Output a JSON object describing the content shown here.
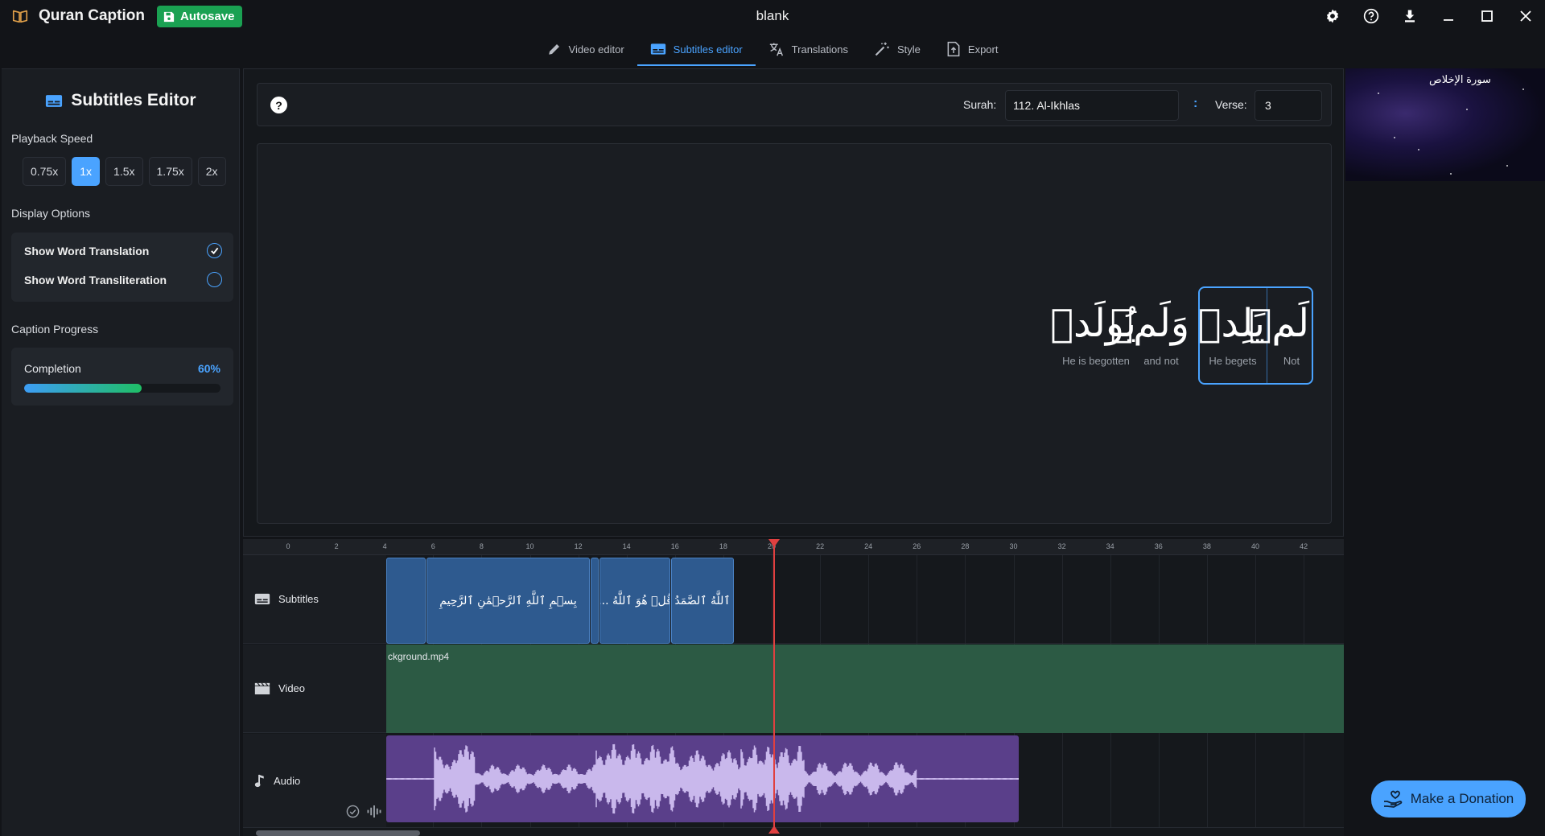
{
  "app": {
    "title": "Quran Caption",
    "autosave_label": "Autosave",
    "project_name": "blank"
  },
  "tabs": [
    {
      "label": "Video editor",
      "icon": "pencil-icon"
    },
    {
      "label": "Subtitles editor",
      "icon": "subtitles-icon"
    },
    {
      "label": "Translations",
      "icon": "translate-icon"
    },
    {
      "label": "Style",
      "icon": "magic-wand-icon"
    },
    {
      "label": "Export",
      "icon": "export-icon"
    }
  ],
  "sidebar": {
    "title": "Subtitles Editor",
    "playback_speed_label": "Playback Speed",
    "speeds": [
      "0.75x",
      "1x",
      "1.5x",
      "1.75x",
      "2x"
    ],
    "active_speed": "1x",
    "display_options_label": "Display Options",
    "show_word_translation_label": "Show Word Translation",
    "show_word_transliteration_label": "Show Word Transliteration",
    "show_word_translation": true,
    "show_word_transliteration": false,
    "caption_progress_label": "Caption Progress",
    "completion_label": "Completion",
    "completion_text": "60%",
    "completion_value": 0.6
  },
  "editor": {
    "surah_label": "Surah:",
    "surah_value": "112. Al-Ikhlas",
    "colon": ":",
    "verse_label": "Verse:",
    "verse_value": "3",
    "words": [
      {
        "arabic": "لَمۡ",
        "translation": "Not"
      },
      {
        "arabic": "يَلِدۡ",
        "translation": "He begets"
      },
      {
        "arabic": "وَلَمۡ",
        "translation": "and not"
      },
      {
        "arabic": "يُولَدۡ",
        "translation": "He is begotten"
      }
    ]
  },
  "preview": {
    "caption": "سورة الإخلاص"
  },
  "timeline": {
    "ticks": [
      "0",
      "2",
      "4",
      "6",
      "8",
      "10",
      "12",
      "14",
      "16",
      "18",
      "20",
      "22",
      "24",
      "26",
      "28",
      "30",
      "32",
      "34",
      "36",
      "38",
      "40",
      "42"
    ],
    "tracks": {
      "subtitles": "Subtitles",
      "video": "Video",
      "audio": "Audio"
    },
    "subtitle_blocks": [
      {
        "text": ""
      },
      {
        "text": "بِسۡمِ ٱللَّهِ ٱلرَّحۡمَٰنِ ٱلرَّحِيمِ"
      },
      {
        "text": ""
      },
      {
        "text": "قُلۡ هُوَ ٱللَّهُ ..."
      },
      {
        "text": "ٱللَّهُ ٱلصَّمَدُ"
      }
    ],
    "video_file": "ckground.mp4"
  },
  "donate_label": "Make a Donation",
  "colors": {
    "accent": "#4aa3ff",
    "autosave": "#1aa152",
    "video_track": "#2c5a44",
    "audio_track": "#5a3f8a",
    "subtitle_block": "#2e5a8f",
    "playhead": "#e04040"
  }
}
